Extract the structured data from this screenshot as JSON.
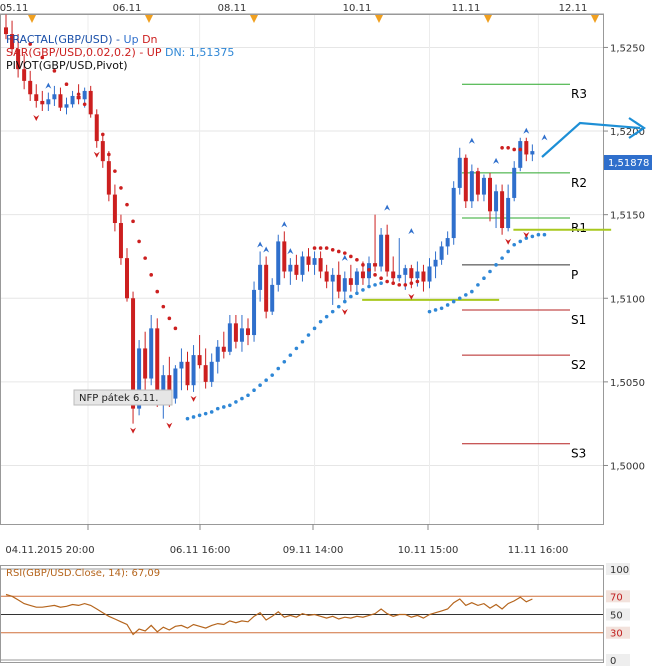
{
  "colors": {
    "bull": "#2f6fcc",
    "bear": "#cc1f1f",
    "sar_up": "#cc1f1f",
    "sar_dn": "#2f87d6",
    "pivot_green": "#2ca82c",
    "pivot_red": "#b52020",
    "pivot_black": "#333333",
    "rsi": "#b5651d",
    "arrow": "#1d8fd6",
    "nfp_box": "#e6e6e6",
    "price_tag": "#2f6fcc"
  },
  "legend": {
    "fractal": "FRACTAL(GBP/USD) -",
    "fractal_up": "Up",
    "fractal_dn": "Dn",
    "sar": "SAR(GBP/USD,0.02,0.2) -",
    "sar_up": "UP",
    "sar_dn": "DN: 1,51375",
    "pivot": "PIVOT(GBP/USD,Pivot)"
  },
  "annotations": {
    "nfp": "NFP pátek 6.11.",
    "current_price": "1,51878"
  },
  "rsi_panel": {
    "label": "RSI(GBP/USD.Close, 14): 67,09",
    "ticks": [
      "100",
      "70",
      "50",
      "30",
      "0"
    ]
  },
  "top_dates": [
    "05.11",
    "06.11",
    "08.11",
    "10.11",
    "11.11",
    "12.11"
  ],
  "pivot_labels": [
    "R3",
    "R2",
    "R1",
    "P",
    "S1",
    "S2",
    "S3"
  ],
  "chart_data": {
    "type": "candlestick",
    "symbol": "GBP/USD",
    "ylim": [
      1.4965,
      1.527
    ],
    "y_ticks": [
      "1,5000",
      "1,5050",
      "1,5100",
      "1,5150",
      "1,5200",
      "1,5250"
    ],
    "x_ticks": [
      "04.11.2015 20:00",
      "06.11 16:00",
      "09.11 14:00",
      "10.11 15:00",
      "11.11 16:00"
    ],
    "candles": [
      [
        1.5262,
        1.527,
        1.5255,
        1.5258
      ],
      [
        1.5258,
        1.5266,
        1.5246,
        1.5249
      ],
      [
        1.5249,
        1.5258,
        1.5232,
        1.5237
      ],
      [
        1.5237,
        1.5246,
        1.5225,
        1.523
      ],
      [
        1.523,
        1.5236,
        1.5218,
        1.5222
      ],
      [
        1.5222,
        1.5228,
        1.5214,
        1.5218
      ],
      [
        1.5218,
        1.5224,
        1.5212,
        1.5216
      ],
      [
        1.5216,
        1.5223,
        1.5212,
        1.5219
      ],
      [
        1.5219,
        1.5227,
        1.5215,
        1.5222
      ],
      [
        1.5222,
        1.5226,
        1.5212,
        1.5214
      ],
      [
        1.5214,
        1.522,
        1.521,
        1.5216
      ],
      [
        1.5216,
        1.5224,
        1.5214,
        1.5221
      ],
      [
        1.5221,
        1.5228,
        1.5216,
        1.5219
      ],
      [
        1.5219,
        1.5226,
        1.5214,
        1.5224
      ],
      [
        1.5224,
        1.5227,
        1.5208,
        1.521
      ],
      [
        1.521,
        1.5213,
        1.519,
        1.5194
      ],
      [
        1.5194,
        1.5198,
        1.5178,
        1.5182
      ],
      [
        1.5182,
        1.5188,
        1.5158,
        1.5162
      ],
      [
        1.5162,
        1.5168,
        1.514,
        1.5145
      ],
      [
        1.5145,
        1.515,
        1.512,
        1.5124
      ],
      [
        1.5124,
        1.513,
        1.5098,
        1.51
      ],
      [
        1.51,
        1.5104,
        1.5025,
        1.5034
      ],
      [
        1.5034,
        1.5075,
        1.503,
        1.507
      ],
      [
        1.507,
        1.508,
        1.5045,
        1.5052
      ],
      [
        1.5052,
        1.509,
        1.5048,
        1.5082
      ],
      [
        1.5082,
        1.5088,
        1.5035,
        1.5038
      ],
      [
        1.5038,
        1.506,
        1.5028,
        1.5054
      ],
      [
        1.5054,
        1.5065,
        1.5035,
        1.504
      ],
      [
        1.504,
        1.506,
        1.5037,
        1.5058
      ],
      [
        1.5058,
        1.507,
        1.5045,
        1.5062
      ],
      [
        1.5062,
        1.5068,
        1.5045,
        1.5048
      ],
      [
        1.5048,
        1.5072,
        1.5044,
        1.5066
      ],
      [
        1.5066,
        1.5078,
        1.5058,
        1.506
      ],
      [
        1.506,
        1.507,
        1.5046,
        1.505
      ],
      [
        1.505,
        1.5067,
        1.5047,
        1.5062
      ],
      [
        1.5062,
        1.5075,
        1.5055,
        1.5071
      ],
      [
        1.5071,
        1.508,
        1.5064,
        1.5068
      ],
      [
        1.5068,
        1.509,
        1.5066,
        1.5085
      ],
      [
        1.5085,
        1.509,
        1.507,
        1.5074
      ],
      [
        1.5074,
        1.509,
        1.5068,
        1.5082
      ],
      [
        1.5082,
        1.5088,
        1.5072,
        1.5078
      ],
      [
        1.5078,
        1.511,
        1.5074,
        1.5105
      ],
      [
        1.5105,
        1.5128,
        1.5098,
        1.512
      ],
      [
        1.512,
        1.5125,
        1.5088,
        1.5092
      ],
      [
        1.5092,
        1.5112,
        1.509,
        1.5108
      ],
      [
        1.5108,
        1.5138,
        1.5104,
        1.5134
      ],
      [
        1.5134,
        1.514,
        1.5112,
        1.5116
      ],
      [
        1.5116,
        1.5124,
        1.5108,
        1.512
      ],
      [
        1.512,
        1.5126,
        1.5111,
        1.5114
      ],
      [
        1.5114,
        1.5128,
        1.511,
        1.5125
      ],
      [
        1.5125,
        1.513,
        1.5116,
        1.512
      ],
      [
        1.512,
        1.5128,
        1.5114,
        1.5124
      ],
      [
        1.5124,
        1.5128,
        1.5112,
        1.5116
      ],
      [
        1.5116,
        1.512,
        1.5106,
        1.511
      ],
      [
        1.511,
        1.5118,
        1.5096,
        1.5114
      ],
      [
        1.5114,
        1.5122,
        1.51,
        1.5104
      ],
      [
        1.5104,
        1.5116,
        1.5098,
        1.5112
      ],
      [
        1.5112,
        1.512,
        1.5104,
        1.5108
      ],
      [
        1.5108,
        1.5118,
        1.5103,
        1.5116
      ],
      [
        1.5116,
        1.5122,
        1.5108,
        1.5112
      ],
      [
        1.5112,
        1.5125,
        1.5108,
        1.5121
      ],
      [
        1.5121,
        1.515,
        1.5116,
        1.5119
      ],
      [
        1.5119,
        1.5142,
        1.5116,
        1.5138
      ],
      [
        1.5138,
        1.5144,
        1.5113,
        1.5116
      ],
      [
        1.5116,
        1.5125,
        1.5108,
        1.5112
      ],
      [
        1.5112,
        1.5136,
        1.511,
        1.5114
      ],
      [
        1.5114,
        1.512,
        1.5105,
        1.5118
      ],
      [
        1.5118,
        1.512,
        1.5106,
        1.5112
      ],
      [
        1.5112,
        1.5122,
        1.5107,
        1.5116
      ],
      [
        1.5116,
        1.512,
        1.5104,
        1.511
      ],
      [
        1.511,
        1.5124,
        1.5106,
        1.5119
      ],
      [
        1.5119,
        1.5128,
        1.5112,
        1.5123
      ],
      [
        1.5123,
        1.5134,
        1.512,
        1.5131
      ],
      [
        1.5131,
        1.514,
        1.5126,
        1.5136
      ],
      [
        1.5136,
        1.517,
        1.5132,
        1.5166
      ],
      [
        1.5166,
        1.519,
        1.5162,
        1.5184
      ],
      [
        1.5184,
        1.5186,
        1.5154,
        1.5158
      ],
      [
        1.5158,
        1.518,
        1.5154,
        1.5176
      ],
      [
        1.5176,
        1.5178,
        1.5158,
        1.5162
      ],
      [
        1.5162,
        1.5174,
        1.5158,
        1.5172
      ],
      [
        1.5172,
        1.5175,
        1.5146,
        1.5152
      ],
      [
        1.5152,
        1.5168,
        1.5142,
        1.5164
      ],
      [
        1.5164,
        1.5168,
        1.5138,
        1.5142
      ],
      [
        1.5142,
        1.5168,
        1.514,
        1.516
      ],
      [
        1.516,
        1.5182,
        1.5158,
        1.5178
      ],
      [
        1.5178,
        1.5196,
        1.5176,
        1.5194
      ],
      [
        1.5194,
        1.5196,
        1.5182,
        1.5186
      ],
      [
        1.5186,
        1.5192,
        1.5182,
        1.5188
      ]
    ],
    "fractals_up": [
      [
        7,
        1.5223
      ],
      [
        42,
        1.5128
      ],
      [
        43,
        1.5125
      ],
      [
        46,
        1.514
      ],
      [
        47,
        1.5124
      ],
      [
        56,
        1.512
      ],
      [
        63,
        1.515
      ],
      [
        67,
        1.5136
      ],
      [
        77,
        1.519
      ],
      [
        81,
        1.5178
      ],
      [
        86,
        1.5196
      ],
      [
        89,
        1.5192
      ]
    ],
    "fractals_dn": [
      [
        5,
        1.5212
      ],
      [
        15,
        1.519
      ],
      [
        21,
        1.5025
      ],
      [
        27,
        1.5028
      ],
      [
        31,
        1.5044
      ],
      [
        56,
        1.5096
      ],
      [
        67,
        1.5105
      ],
      [
        83,
        1.5138
      ],
      [
        86,
        1.5142
      ]
    ],
    "sar_up": [
      [
        4,
        1.5252
      ],
      [
        6,
        1.5244
      ],
      [
        8,
        1.5236
      ],
      [
        10,
        1.5228
      ],
      [
        12,
        1.5222
      ],
      [
        13,
        1.5216
      ],
      [
        15,
        1.5208
      ],
      [
        16,
        1.5198
      ],
      [
        17,
        1.5186
      ],
      [
        18,
        1.5176
      ],
      [
        19,
        1.5166
      ],
      [
        20,
        1.5156
      ],
      [
        21,
        1.5146
      ],
      [
        22,
        1.5134
      ],
      [
        23,
        1.5124
      ],
      [
        24,
        1.5114
      ],
      [
        25,
        1.5104
      ],
      [
        26,
        1.5095
      ],
      [
        27,
        1.5088
      ],
      [
        28,
        1.5082
      ],
      [
        51,
        1.513
      ],
      [
        52,
        1.513
      ],
      [
        53,
        1.513
      ],
      [
        54,
        1.5129
      ],
      [
        55,
        1.5128
      ],
      [
        56,
        1.5127
      ],
      [
        57,
        1.5125
      ],
      [
        58,
        1.5123
      ],
      [
        59,
        1.512
      ],
      [
        60,
        1.5117
      ],
      [
        61,
        1.5114
      ],
      [
        62,
        1.5112
      ],
      [
        63,
        1.511
      ],
      [
        64,
        1.5109
      ],
      [
        65,
        1.5108
      ],
      [
        66,
        1.5108
      ],
      [
        67,
        1.5109
      ],
      [
        68,
        1.511
      ],
      [
        69,
        1.5112
      ],
      [
        82,
        1.519
      ],
      [
        83,
        1.519
      ],
      [
        84,
        1.5189
      ],
      [
        85,
        1.5189
      ],
      [
        86,
        1.5188
      ]
    ],
    "sar_dn": [
      [
        30,
        1.5028
      ],
      [
        31,
        1.5029
      ],
      [
        32,
        1.503
      ],
      [
        33,
        1.5031
      ],
      [
        34,
        1.5032
      ],
      [
        35,
        1.5034
      ],
      [
        36,
        1.5035
      ],
      [
        37,
        1.5036
      ],
      [
        38,
        1.5038
      ],
      [
        39,
        1.504
      ],
      [
        40,
        1.5042
      ],
      [
        41,
        1.5045
      ],
      [
        42,
        1.5048
      ],
      [
        43,
        1.5051
      ],
      [
        44,
        1.5054
      ],
      [
        45,
        1.5058
      ],
      [
        46,
        1.5062
      ],
      [
        47,
        1.5066
      ],
      [
        48,
        1.507
      ],
      [
        49,
        1.5074
      ],
      [
        50,
        1.5078
      ],
      [
        51,
        1.5082
      ],
      [
        52,
        1.5086
      ],
      [
        53,
        1.5089
      ],
      [
        54,
        1.5092
      ],
      [
        55,
        1.5095
      ],
      [
        56,
        1.5098
      ],
      [
        57,
        1.5101
      ],
      [
        58,
        1.5103
      ],
      [
        59,
        1.5105
      ],
      [
        60,
        1.5107
      ],
      [
        61,
        1.5108
      ],
      [
        62,
        1.5109
      ],
      [
        70,
        1.5092
      ],
      [
        71,
        1.5093
      ],
      [
        72,
        1.5094
      ],
      [
        73,
        1.5096
      ],
      [
        74,
        1.5098
      ],
      [
        75,
        1.51
      ],
      [
        76,
        1.5102
      ],
      [
        77,
        1.5104
      ],
      [
        78,
        1.5108
      ],
      [
        79,
        1.5112
      ],
      [
        80,
        1.5116
      ],
      [
        81,
        1.512
      ],
      [
        82,
        1.5124
      ],
      [
        83,
        1.5128
      ],
      [
        84,
        1.5132
      ],
      [
        85,
        1.5134
      ],
      [
        86,
        1.5136
      ],
      [
        87,
        1.5137
      ],
      [
        88,
        1.5138
      ],
      [
        89,
        1.5138
      ]
    ],
    "yellow_lines": [
      {
        "y": 1.5099,
        "x0": 63,
        "x1": 103
      },
      {
        "y": 1.5141,
        "x0": 88,
        "x1": 103
      }
    ],
    "pivots": [
      {
        "label": "R3",
        "y": 1.5228,
        "style": "green"
      },
      {
        "label": "R2",
        "y": 1.5175,
        "style": "green"
      },
      {
        "label": "R1",
        "y": 1.5148,
        "style": "green"
      },
      {
        "label": "P",
        "y": 1.512,
        "style": "black"
      },
      {
        "label": "S1",
        "y": 1.5093,
        "style": "red"
      },
      {
        "label": "S2",
        "y": 1.5066,
        "style": "red"
      },
      {
        "label": "S3",
        "y": 1.5013,
        "style": "red"
      }
    ],
    "rsi_ylim": [
      0,
      100
    ],
    "rsi_levels": [
      70,
      50,
      30
    ],
    "rsi": [
      72,
      70,
      66,
      62,
      60,
      58,
      58,
      59,
      60,
      58,
      59,
      61,
      60,
      62,
      60,
      56,
      52,
      48,
      45,
      42,
      39,
      28,
      34,
      32,
      38,
      31,
      36,
      33,
      37,
      38,
      35,
      39,
      37,
      35,
      38,
      40,
      39,
      43,
      41,
      43,
      42,
      48,
      52,
      44,
      48,
      53,
      47,
      49,
      47,
      51,
      49,
      50,
      48,
      46,
      48,
      45,
      47,
      46,
      48,
      47,
      49,
      51,
      56,
      51,
      48,
      50,
      50,
      47,
      49,
      46,
      50,
      52,
      54,
      56,
      63,
      67,
      60,
      63,
      60,
      62,
      57,
      61,
      56,
      62,
      65,
      69,
      64,
      67
    ]
  }
}
